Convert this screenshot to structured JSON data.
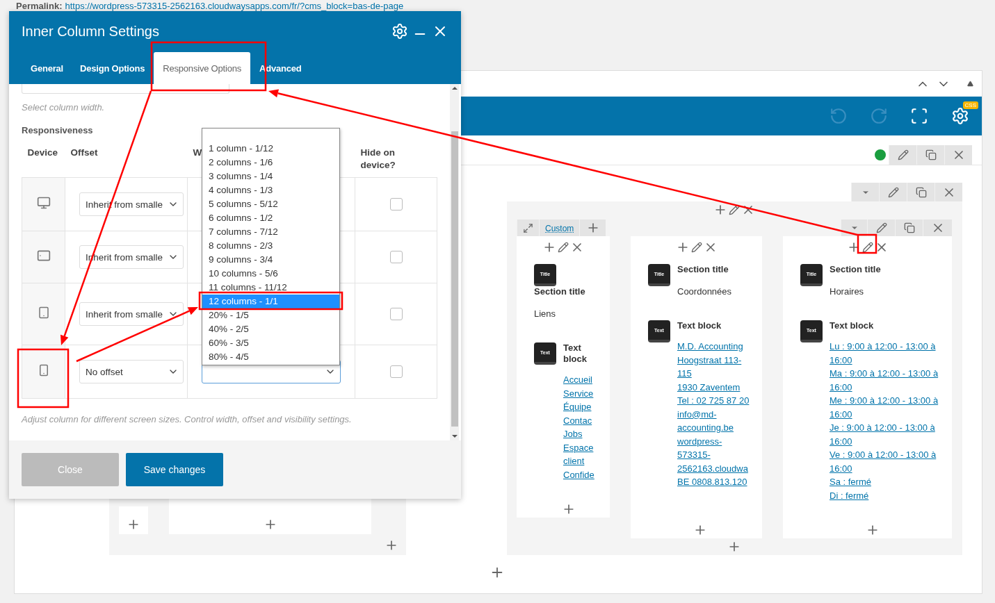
{
  "permalink": {
    "label": "Permalink:",
    "url": "https://wordpress-573315-2562163.cloudwaysapps.com/fr/?cms_block=bas-de-page"
  },
  "dialog": {
    "title": "Inner Column Settings",
    "tabs": [
      {
        "label": "General",
        "selected": false
      },
      {
        "label": "Design Options",
        "selected": false
      },
      {
        "label": "Responsive Options",
        "selected": true
      },
      {
        "label": "Advanced",
        "selected": false
      }
    ],
    "width_hint": "Select column width.",
    "section_label": "Responsiveness",
    "columns": [
      "Device",
      "Offset",
      "W",
      "Hide on device?"
    ],
    "rows": [
      {
        "kind": "desktop",
        "offset": "Inherit from smalle",
        "checked": false
      },
      {
        "kind": "tablet-landscape",
        "offset": "Inherit from smalle",
        "checked": false
      },
      {
        "kind": "tablet-portrait",
        "offset": "Inherit from smalle",
        "checked": false
      },
      {
        "kind": "phone",
        "offset": "No offset",
        "width_field": {
          "focused": true
        },
        "checked": false
      }
    ],
    "width_options": [
      {
        "label": "1 column - 1/12",
        "selected": false
      },
      {
        "label": "2 columns - 1/6",
        "selected": false
      },
      {
        "label": "3 columns - 1/4",
        "selected": false
      },
      {
        "label": "4 columns - 1/3",
        "selected": false
      },
      {
        "label": "5 columns - 5/12",
        "selected": false
      },
      {
        "label": "6 columns - 1/2",
        "selected": false
      },
      {
        "label": "7 columns - 7/12",
        "selected": false
      },
      {
        "label": "8 columns - 2/3",
        "selected": false
      },
      {
        "label": "9 columns - 3/4",
        "selected": false
      },
      {
        "label": "10 columns - 5/6",
        "selected": false
      },
      {
        "label": "11 columns - 11/12",
        "selected": false
      },
      {
        "label": "12 columns - 1/1",
        "selected": true
      },
      {
        "label": "20% - 1/5",
        "selected": false
      },
      {
        "label": "40% - 2/5",
        "selected": false
      },
      {
        "label": "60% - 3/5",
        "selected": false
      },
      {
        "label": "80% - 4/5",
        "selected": false
      }
    ],
    "help": "Adjust column for different screen sizes. Control width, offset and visibility settings.",
    "buttons": [
      {
        "label": "Close",
        "kind": "secondary"
      },
      {
        "label": "Save changes",
        "kind": "primary"
      }
    ]
  },
  "builder": {
    "css_badge": "CSS",
    "custom_label": "Custom",
    "columns": [
      {
        "title_icon": "Title",
        "title_label": "Section title",
        "title_text": "Liens",
        "text_icon": "Text",
        "text_label": "Text block",
        "links": [
          "Accueil",
          "Service",
          "Équipe",
          "Contac",
          "Jobs",
          "Espace client",
          "Confide"
        ]
      },
      {
        "title_icon": "Title",
        "title_label": "Section title",
        "title_text": "Coordonnées",
        "text_icon": "Text",
        "text_label": "Text block",
        "links": [
          "M.D. Accounting",
          "Hoogstraat 113-115",
          "1930 Zaventem",
          "Tel : 02 725 87 20",
          "info@md-accounting.be",
          "wordpress-573315-2562163.cloudwa",
          "BE 0808.813.120"
        ]
      },
      {
        "title_icon": "Title",
        "title_label": "Section title",
        "title_text": "Horaires",
        "text_icon": "Text",
        "text_label": "Text block",
        "links": [
          "Lu : 9:00 à 12:00 - 13:00 à 16:00",
          "Ma : 9:00 à 12:00 - 13:00 à 16:00",
          "Me : 9:00 à 12:00 - 13:00 à 16:00",
          "Je : 9:00 à 12:00 - 13:00 à 16:00",
          "Ve : 9:00 à 12:00 - 13:00 à 16:00",
          "Sa : fermé",
          "Di : fermé"
        ]
      }
    ]
  }
}
